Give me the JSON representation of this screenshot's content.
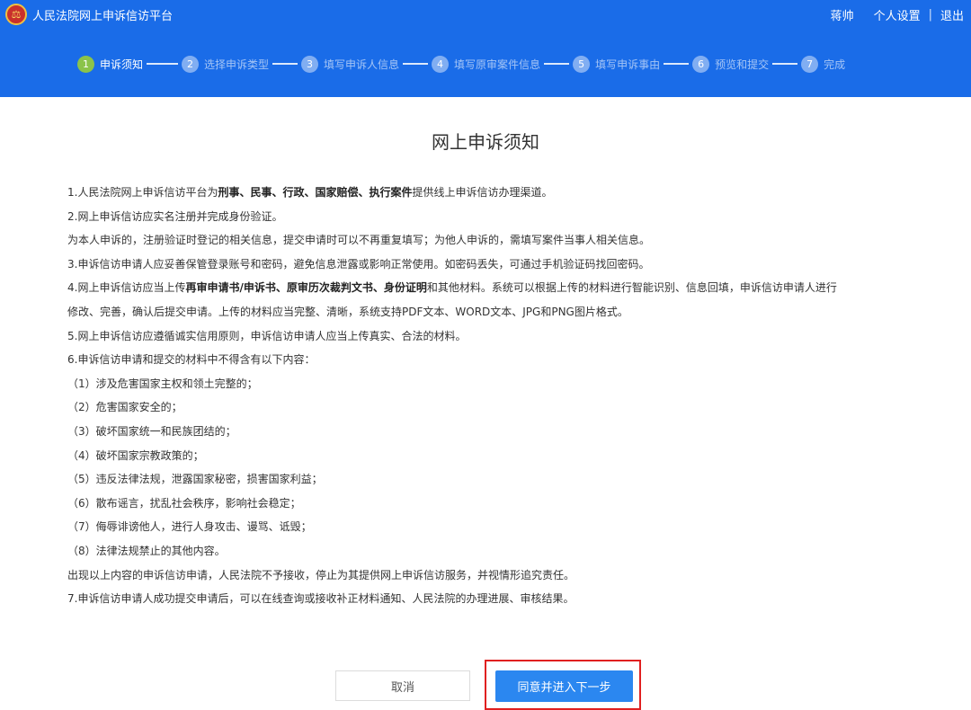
{
  "header": {
    "title": "人民法院网上申诉信访平台",
    "user_name": "蒋帅",
    "settings_label": "个人设置",
    "separator": "|",
    "logout_label": "退出",
    "color": "#1a6ce8"
  },
  "steps": [
    {
      "num": "1",
      "label": "申诉须知",
      "active": true
    },
    {
      "num": "2",
      "label": "选择申诉类型",
      "active": false
    },
    {
      "num": "3",
      "label": "填写申诉人信息",
      "active": false
    },
    {
      "num": "4",
      "label": "填写原审案件信息",
      "active": false
    },
    {
      "num": "5",
      "label": "填写申诉事由",
      "active": false
    },
    {
      "num": "6",
      "label": "预览和提交",
      "active": false
    },
    {
      "num": "7",
      "label": "完成",
      "active": false
    }
  ],
  "notice": {
    "title": "网上申诉须知",
    "lines": [
      [
        {
          "t": "1.人民法院网上申诉信访平台为"
        },
        {
          "t": "刑事、民事、行政、国家赔偿、执行案件",
          "b": true
        },
        {
          "t": "提供线上申诉信访办理渠道。"
        }
      ],
      [
        {
          "t": "2.网上申诉信访应实名注册并完成身份验证。"
        }
      ],
      [
        {
          "t": "为本人申诉的，注册验证时登记的相关信息，提交申请时可以不再重复填写；为他人申诉的，需填写案件当事人相关信息。"
        }
      ],
      [
        {
          "t": "3.申诉信访申请人应妥善保管登录账号和密码，避免信息泄露或影响正常使用。如密码丢失，可通过手机验证码找回密码。"
        }
      ],
      [
        {
          "t": "4.网上申诉信访应当上传"
        },
        {
          "t": "再审申请书/申诉书、原审历次裁判文书、身份证明",
          "b": true
        },
        {
          "t": "和其他材料。系统可以根据上传的材料进行智能识别、信息回填，申诉信访申请人进行"
        }
      ],
      [
        {
          "t": "修改、完善，确认后提交申请。上传的材料应当完整、清晰，系统支持PDF文本、WORD文本、JPG和PNG图片格式。"
        }
      ],
      [
        {
          "t": "5.网上申诉信访应遵循诚实信用原则，申诉信访申请人应当上传真实、合法的材料。"
        }
      ],
      [
        {
          "t": "6.申诉信访申请和提交的材料中不得含有以下内容："
        }
      ],
      [
        {
          "t": "（1）涉及危害国家主权和领土完整的；"
        }
      ],
      [
        {
          "t": "（2）危害国家安全的；"
        }
      ],
      [
        {
          "t": "（3）破坏国家统一和民族团结的；"
        }
      ],
      [
        {
          "t": "（4）破坏国家宗教政策的；"
        }
      ],
      [
        {
          "t": "（5）违反法律法规，泄露国家秘密，损害国家利益；"
        }
      ],
      [
        {
          "t": "（6）散布谣言，扰乱社会秩序，影响社会稳定；"
        }
      ],
      [
        {
          "t": "（7）侮辱诽谤他人，进行人身攻击、谩骂、诋毁；"
        }
      ],
      [
        {
          "t": "（8）法律法规禁止的其他内容。"
        }
      ],
      [
        {
          "t": "出现以上内容的申诉信访申请，人民法院不予接收，停止为其提供网上申诉信访服务，并视情形追究责任。"
        }
      ],
      [
        {
          "t": "7.申诉信访申请人成功提交申请后，可以在线查询或接收补正材料通知、人民法院的办理进展、审核结果。"
        }
      ]
    ]
  },
  "buttons": {
    "cancel_label": "取消",
    "agree_label": "同意并进入下一步",
    "agree_color": "#2b87f0",
    "highlight_color": "#e02020"
  }
}
